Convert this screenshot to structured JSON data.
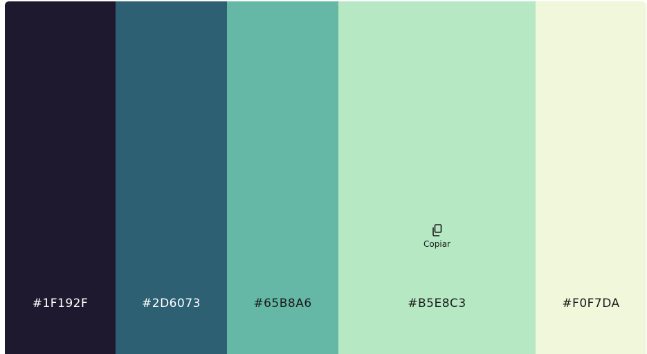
{
  "palette": {
    "swatches": [
      {
        "hex": "#1F192F",
        "color": "#1F192F",
        "tone": "dark"
      },
      {
        "hex": "#2D6073",
        "color": "#2D6073",
        "tone": "dark"
      },
      {
        "hex": "#65B8A6",
        "color": "#65B8A6",
        "tone": "light"
      },
      {
        "hex": "#B5E8C3",
        "color": "#B5E8C3",
        "tone": "light"
      },
      {
        "hex": "#F0F7DA",
        "color": "#F0F7DA",
        "tone": "light"
      }
    ],
    "hovered_swatch_index": 3,
    "copy": {
      "label": "Copiar",
      "icon": "copy-icon"
    }
  }
}
